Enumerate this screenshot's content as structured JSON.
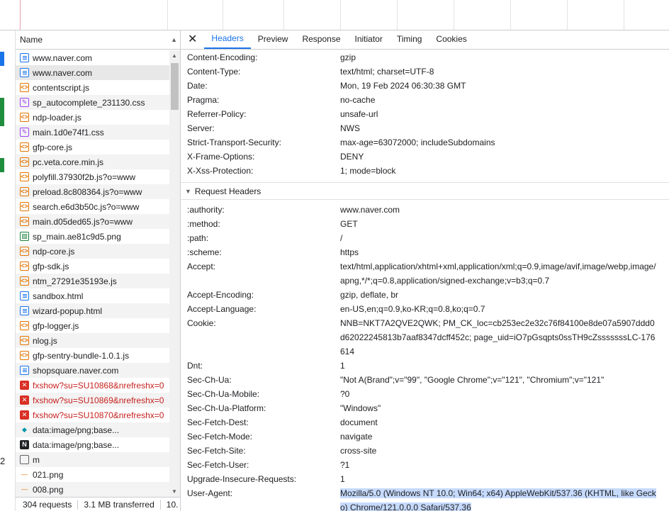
{
  "left_strip": {
    "partial_number": "2"
  },
  "request_list": {
    "column_name": "Name",
    "rows": [
      {
        "name": "www.naver.com",
        "icon": "document-icon",
        "type": "doc"
      },
      {
        "name": "www.naver.com",
        "icon": "document-icon",
        "type": "doc"
      },
      {
        "name": "contentscript.js",
        "icon": "script-icon",
        "type": "js"
      },
      {
        "name": "sp_autocomplete_231130.css",
        "icon": "stylesheet-icon",
        "type": "css"
      },
      {
        "name": "ndp-loader.js",
        "icon": "script-icon",
        "type": "js"
      },
      {
        "name": "main.1d0e74f1.css",
        "icon": "stylesheet-icon",
        "type": "css"
      },
      {
        "name": "gfp-core.js",
        "icon": "script-icon",
        "type": "js"
      },
      {
        "name": "pc.veta.core.min.js",
        "icon": "script-icon",
        "type": "js"
      },
      {
        "name": "polyfill.37930f2b.js?o=www",
        "icon": "script-icon",
        "type": "js"
      },
      {
        "name": "preload.8c808364.js?o=www",
        "icon": "script-icon",
        "type": "js"
      },
      {
        "name": "search.e6d3b50c.js?o=www",
        "icon": "script-icon",
        "type": "js"
      },
      {
        "name": "main.d05ded65.js?o=www",
        "icon": "script-icon",
        "type": "js"
      },
      {
        "name": "sp_main.ae81c9d5.png",
        "icon": "image-icon",
        "type": "img"
      },
      {
        "name": "ndp-core.js",
        "icon": "script-icon",
        "type": "js"
      },
      {
        "name": "gfp-sdk.js",
        "icon": "script-icon",
        "type": "js"
      },
      {
        "name": "ntm_27291e35193e.js",
        "icon": "script-icon",
        "type": "js"
      },
      {
        "name": "sandbox.html",
        "icon": "document-icon",
        "type": "doc"
      },
      {
        "name": "wizard-popup.html",
        "icon": "document-icon",
        "type": "doc"
      },
      {
        "name": "gfp-logger.js",
        "icon": "script-icon",
        "type": "js"
      },
      {
        "name": "nlog.js",
        "icon": "script-icon",
        "type": "js"
      },
      {
        "name": "gfp-sentry-bundle-1.0.1.js",
        "icon": "script-icon",
        "type": "js"
      },
      {
        "name": "shopsquare.naver.com",
        "icon": "document-icon",
        "type": "doc"
      },
      {
        "name": "fxshow?su=SU10868&nrefreshx=0",
        "icon": "error-icon",
        "type": "err"
      },
      {
        "name": "fxshow?su=SU10869&nrefreshx=0",
        "icon": "error-icon",
        "type": "err"
      },
      {
        "name": "fxshow?su=SU10870&nrefreshx=0",
        "icon": "error-icon",
        "type": "err"
      },
      {
        "name": "data:image/png;base...",
        "icon": "fetch-icon",
        "type": "fetch"
      },
      {
        "name": "data:image/png;base...",
        "icon": "naver-n-icon",
        "type": "n"
      },
      {
        "name": "m",
        "icon": "blank-icon",
        "type": "box"
      },
      {
        "name": "021.png",
        "icon": "image-dash-icon",
        "type": "dash"
      },
      {
        "name": "008.png",
        "icon": "image-dash-icon",
        "type": "dash"
      }
    ],
    "status": {
      "requests": "304 requests",
      "transferred": "3.1 MB transferred",
      "resources": "10."
    }
  },
  "details": {
    "close_label": "✕",
    "tabs": [
      "Headers",
      "Preview",
      "Response",
      "Initiator",
      "Timing",
      "Cookies"
    ],
    "active_tab": "Headers",
    "response_headers": [
      {
        "key": "Content-Encoding:",
        "value": "gzip"
      },
      {
        "key": "Content-Type:",
        "value": "text/html; charset=UTF-8"
      },
      {
        "key": "Date:",
        "value": "Mon, 19 Feb 2024 06:30:38 GMT"
      },
      {
        "key": "Pragma:",
        "value": "no-cache"
      },
      {
        "key": "Referrer-Policy:",
        "value": "unsafe-url"
      },
      {
        "key": "Server:",
        "value": "NWS"
      },
      {
        "key": "Strict-Transport-Security:",
        "value": "max-age=63072000; includeSubdomains"
      },
      {
        "key": "X-Frame-Options:",
        "value": "DENY"
      },
      {
        "key": "X-Xss-Protection:",
        "value": "1; mode=block"
      }
    ],
    "request_section_title": "Request Headers",
    "request_headers": [
      {
        "key": ":authority:",
        "value": "www.naver.com"
      },
      {
        "key": ":method:",
        "value": "GET"
      },
      {
        "key": ":path:",
        "value": "/"
      },
      {
        "key": ":scheme:",
        "value": "https"
      },
      {
        "key": "Accept:",
        "value": "text/html,application/xhtml+xml,application/xml;q=0.9,image/avif,image/webp,image/apng,*/*;q=0.8,application/signed-exchange;v=b3;q=0.7"
      },
      {
        "key": "Accept-Encoding:",
        "value": "gzip, deflate, br"
      },
      {
        "key": "Accept-Language:",
        "value": "en-US,en;q=0.9,ko-KR;q=0.8,ko;q=0.7"
      },
      {
        "key": "Cookie:",
        "value": "NNB=NKT7A2QVE2QWK; PM_CK_loc=cb253ec2e32c76f84100e8de07a5907ddd0d62022245813b7aaf8347dcff452c; page_uid=iO7pGsqpts0ssTH9cZsssssssLC-176614"
      },
      {
        "key": "Dnt:",
        "value": "1"
      },
      {
        "key": "Sec-Ch-Ua:",
        "value": "\"Not A(Brand\";v=\"99\", \"Google Chrome\";v=\"121\", \"Chromium\";v=\"121\""
      },
      {
        "key": "Sec-Ch-Ua-Mobile:",
        "value": "?0"
      },
      {
        "key": "Sec-Ch-Ua-Platform:",
        "value": "\"Windows\""
      },
      {
        "key": "Sec-Fetch-Dest:",
        "value": "document"
      },
      {
        "key": "Sec-Fetch-Mode:",
        "value": "navigate"
      },
      {
        "key": "Sec-Fetch-Site:",
        "value": "cross-site"
      },
      {
        "key": "Sec-Fetch-User:",
        "value": "?1"
      },
      {
        "key": "Upgrade-Insecure-Requests:",
        "value": "1"
      },
      {
        "key": "User-Agent:",
        "value": "Mozilla/5.0 (Windows NT 10.0; Win64; x64) AppleWebKit/537.36 (KHTML, like Gecko) Chrome/121.0.0.0 Safari/537.36",
        "highlight": true
      }
    ]
  },
  "colors": {
    "accent": "#1a73e8",
    "error": "#c5221f",
    "selection_highlight": "#c6dafc"
  }
}
